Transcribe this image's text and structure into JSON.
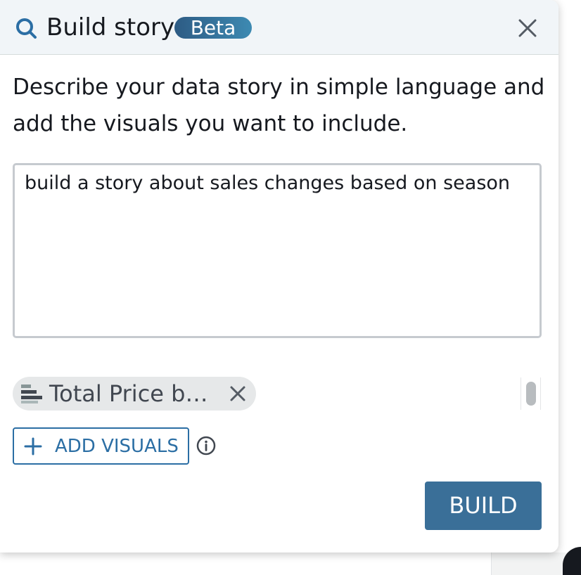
{
  "header": {
    "title": "Build story",
    "badge": "Beta",
    "search_icon": "search-icon",
    "close_icon": "close-icon"
  },
  "description": "Describe your data story in simple language and add the visuals you want to include.",
  "prompt": {
    "value": "build a story about sales changes based on season"
  },
  "visuals": {
    "chip_label": "Total Price b…",
    "chip_icon": "bar-chart-icon",
    "remove_icon": "close-icon"
  },
  "actions": {
    "add_visuals_label": "ADD VISUALS",
    "add_icon": "plus-icon",
    "info_icon": "info-icon",
    "build_label": "BUILD"
  },
  "colors": {
    "header_background": "#f1f5f8",
    "accent": "#2b6ea4",
    "build_button": "#3a6f98",
    "badge_start": "#2d5b84",
    "badge_end": "#3d8ab2",
    "chip_background": "#e6e8e9"
  }
}
